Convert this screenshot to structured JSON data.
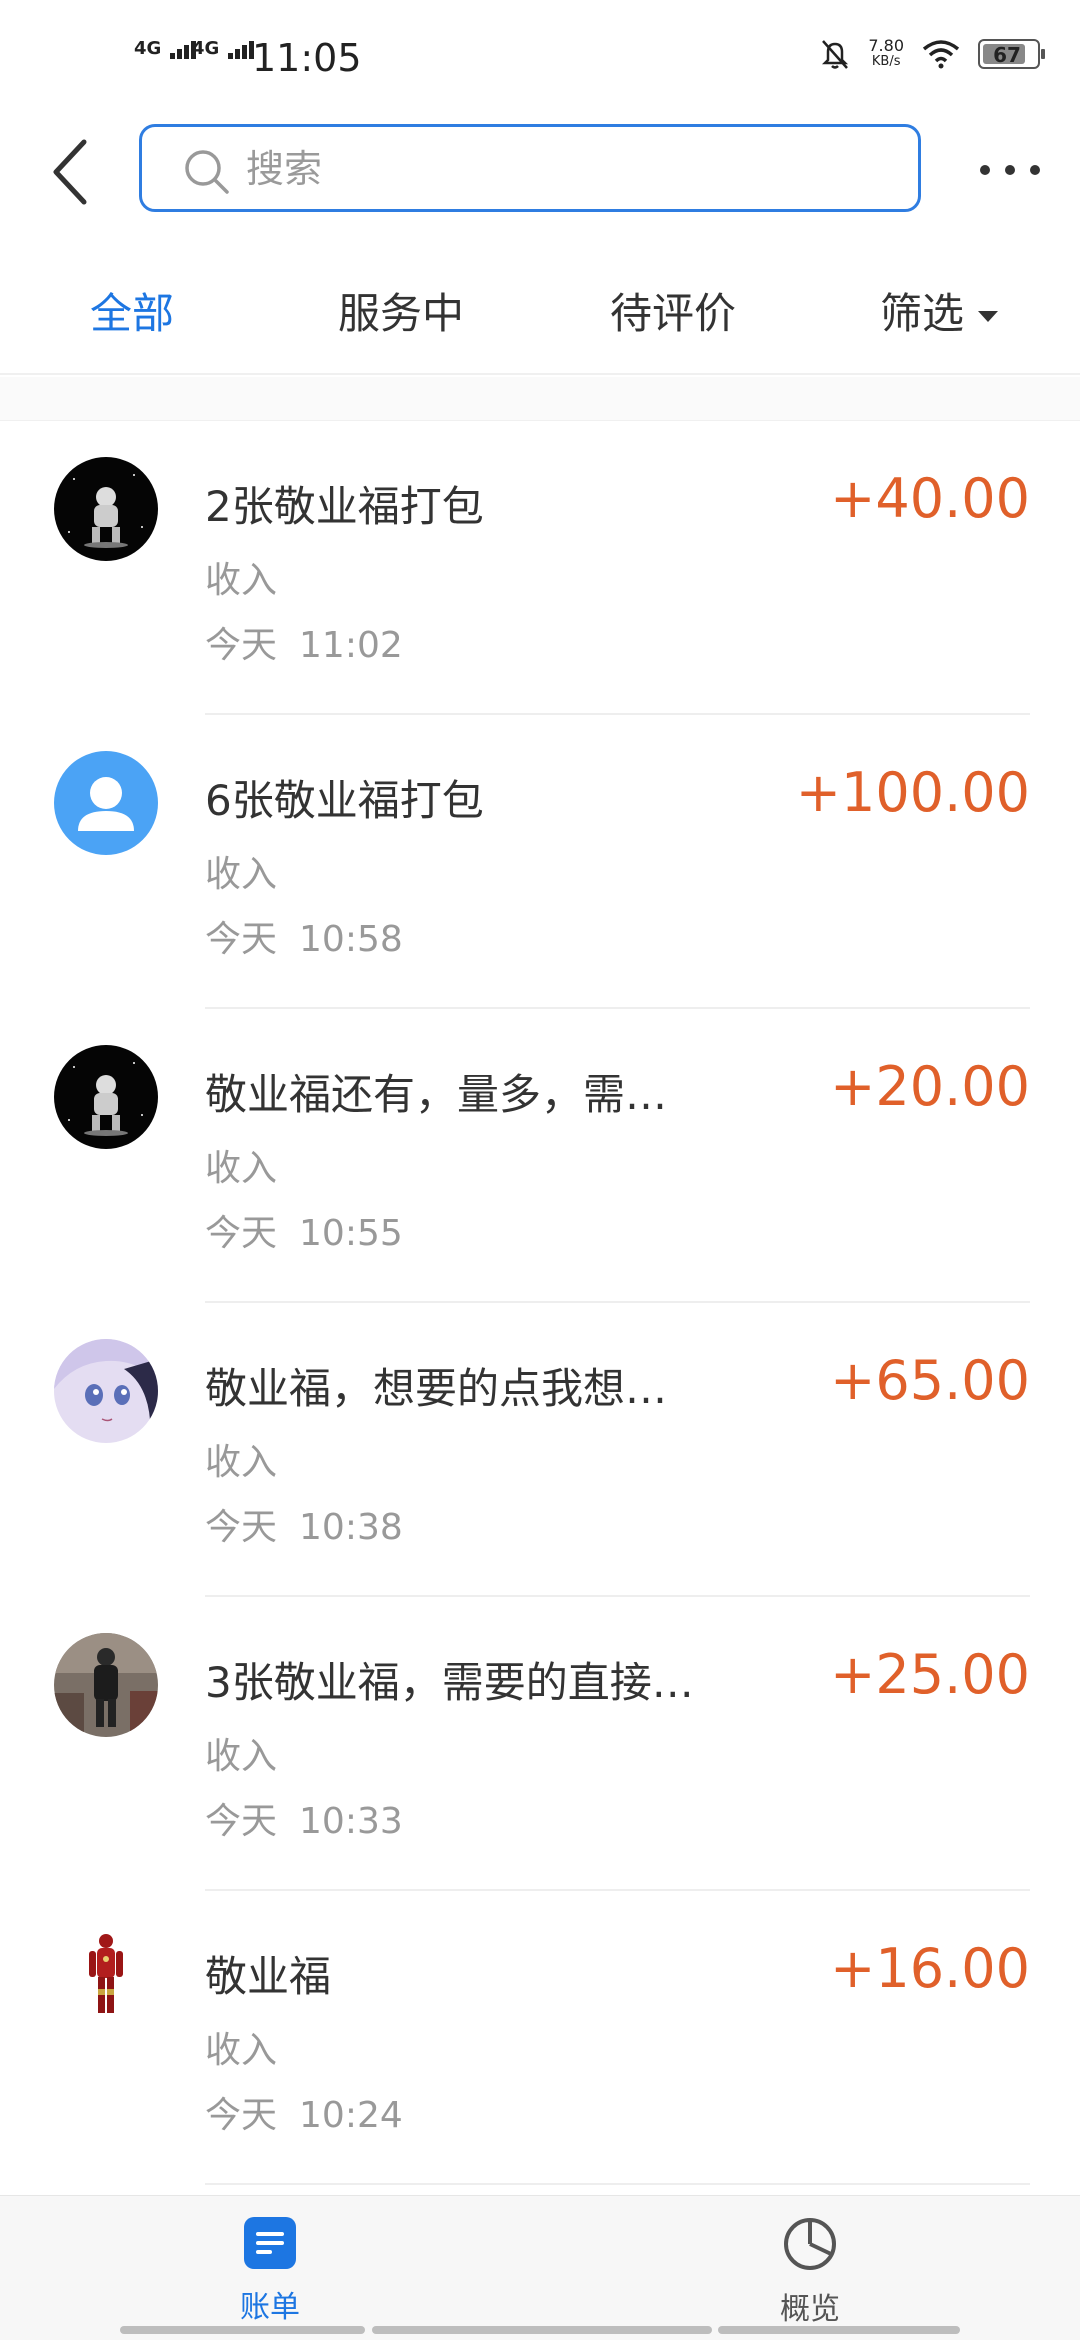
{
  "status_bar": {
    "signal1": "4G",
    "signal2": "4G",
    "time": "11:05",
    "net_speed": "7.80",
    "net_unit": "KB/s",
    "battery": "67"
  },
  "header": {
    "search_placeholder": "搜索"
  },
  "tabs": [
    {
      "label": "全部",
      "active": true
    },
    {
      "label": "服务中",
      "active": false
    },
    {
      "label": "待评价",
      "active": false
    },
    {
      "label": "筛选",
      "active": false
    }
  ],
  "transactions": [
    {
      "title": "2张敬业福打包",
      "type": "收入",
      "day": "今天",
      "time": "11:02",
      "amount": "+40.00",
      "avatar": "astronaut-avatar"
    },
    {
      "title": "6张敬业福打包",
      "type": "收入",
      "day": "今天",
      "time": "10:58",
      "amount": "+100.00",
      "avatar": "default-user-avatar"
    },
    {
      "title": "敬业福还有，量多，需…",
      "type": "收入",
      "day": "今天",
      "time": "10:55",
      "amount": "+20.00",
      "avatar": "astronaut-avatar"
    },
    {
      "title": "敬业福，想要的点我想…",
      "type": "收入",
      "day": "今天",
      "time": "10:38",
      "amount": "+65.00",
      "avatar": "anime-avatar"
    },
    {
      "title": "3张敬业福，需要的直接…",
      "type": "收入",
      "day": "今天",
      "time": "10:33",
      "amount": "+25.00",
      "avatar": "person-photo-avatar"
    },
    {
      "title": "敬业福",
      "type": "收入",
      "day": "今天",
      "time": "10:24",
      "amount": "+16.00",
      "avatar": "ironman-avatar"
    }
  ],
  "bottom_nav": {
    "bill_label": "账单",
    "overview_label": "概览"
  },
  "colors": {
    "accent": "#1d76e2",
    "amount": "#e0602a",
    "secondary_text": "#999999"
  }
}
